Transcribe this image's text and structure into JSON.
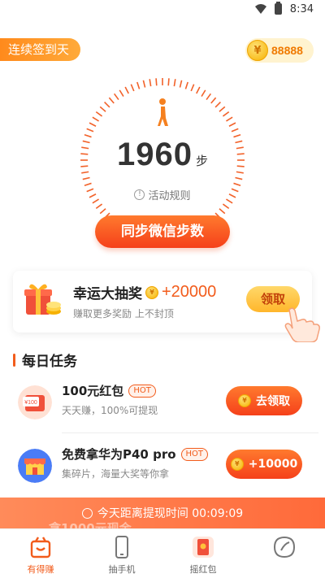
{
  "status_bar": {
    "time": "8:34"
  },
  "header": {
    "streak_label": "连续签到天",
    "coin_balance": "88888",
    "coin_symbol": "¥"
  },
  "gauge": {
    "steps": "1960",
    "unit": "步",
    "rules_label": "活动规则",
    "rules_icon": "!"
  },
  "sync_button": "同步微信步数",
  "lottery": {
    "title": "幸运大抽奖",
    "bonus": "+20000",
    "subtitle": "赚取更多奖励 上不封顶",
    "claim_label": "领取"
  },
  "daily_tasks": {
    "section_title": "每日任务",
    "items": [
      {
        "name": "100元红包",
        "badge": "HOT",
        "desc": "天天赚，100%可提现",
        "button": "去领取",
        "icon_text": "¥100"
      },
      {
        "name": "免费拿华为P40 pro",
        "badge": "HOT",
        "desc": "集碎片，海量大奖等你拿",
        "button": "+10000"
      }
    ]
  },
  "banner": {
    "text": "今天距离提现时间 00:09:09",
    "ghost_text": "拿1000元现金"
  },
  "tabs": [
    {
      "label": "有得赚",
      "icon": "shopping-bag-icon",
      "active": true
    },
    {
      "label": "抽手机",
      "icon": "phone-icon",
      "active": false
    },
    {
      "label": "摇红包",
      "icon": "red-envelope-icon",
      "active": false
    },
    {
      "label": "",
      "icon": "leaf-icon",
      "active": false
    }
  ],
  "colors": {
    "accent": "#f25c1c",
    "gold": "#ffb62b"
  }
}
